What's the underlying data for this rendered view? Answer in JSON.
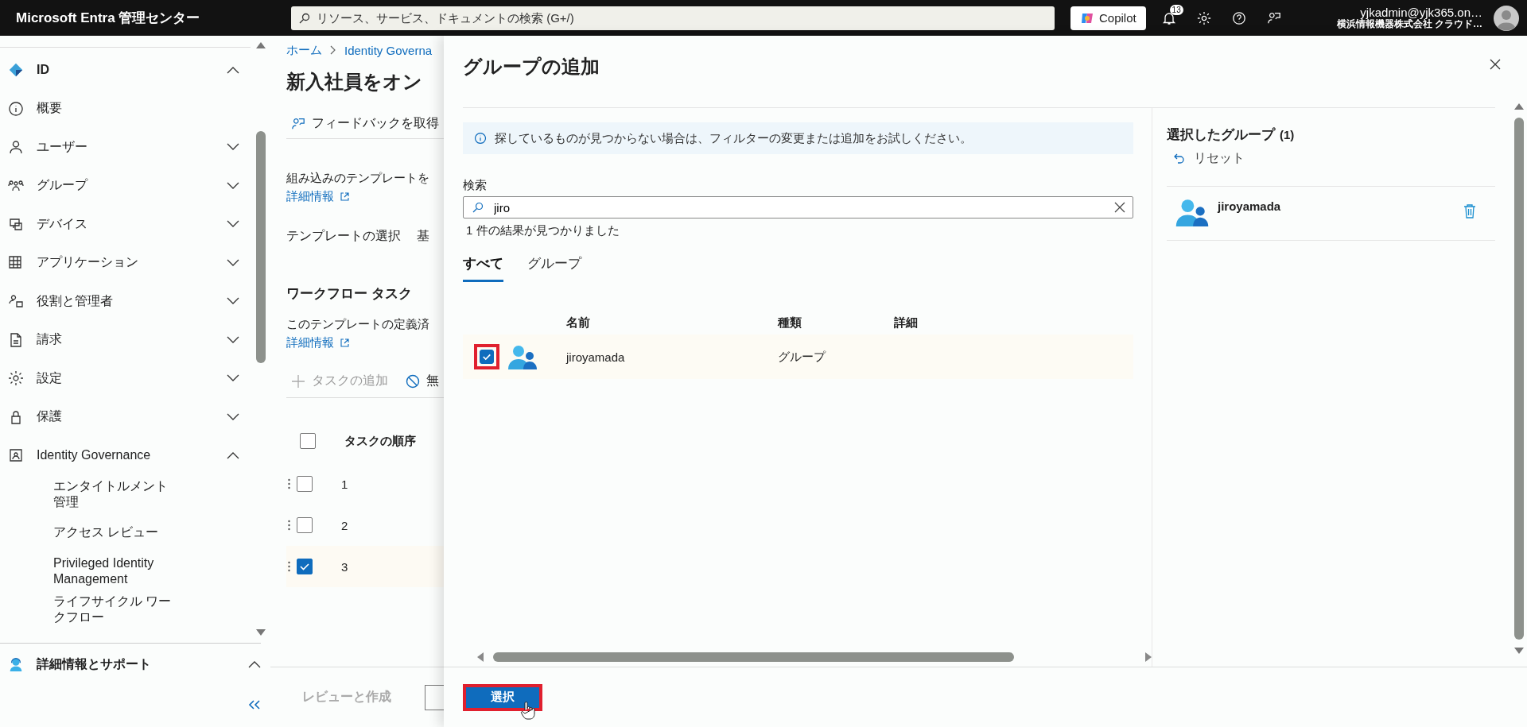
{
  "top_bar": {
    "title": "Microsoft Entra 管理センター",
    "search": {
      "placeholder": "リソース、サービス、ドキュメントの検索 (G+/)"
    },
    "copilot_button": "Copilot",
    "notifications_badge": "13",
    "account": {
      "email": "yjkadmin@yjk365.on…",
      "organization": "横浜情報機器株式会社 クラウド…"
    }
  },
  "sidebar": {
    "items": [
      {
        "label": "ID",
        "expanded": true,
        "children": [
          {
            "label": "概要"
          },
          {
            "label": "ユーザー",
            "expanded": false
          },
          {
            "label": "グループ",
            "expanded": false
          },
          {
            "label": "デバイス",
            "expanded": false
          },
          {
            "label": "アプリケーション",
            "expanded": false
          },
          {
            "label": "役割と管理者",
            "expanded": false
          },
          {
            "label": "請求",
            "expanded": false
          },
          {
            "label": "設定",
            "expanded": false
          },
          {
            "label": "保護",
            "expanded": false
          },
          {
            "label": "Identity Governance",
            "expanded": true,
            "children": [
              {
                "label": "エンタイトルメント管理"
              },
              {
                "label": "アクセス レビュー"
              },
              {
                "label": "Privileged Identity Management"
              },
              {
                "label": "ライフサイクル ワークフロー"
              }
            ]
          }
        ]
      }
    ],
    "support": {
      "label": "詳細情報とサポート",
      "expanded": true
    }
  },
  "background_page": {
    "breadcrumb": [
      "ホーム",
      "Identity Governa"
    ],
    "title": "新入社員をオン",
    "feedback_button": "フィードバックを取得",
    "description": "組み込みのテンプレートを",
    "learn_more_link": "詳細情報",
    "tabs": [
      "テンプレートの選択",
      "基"
    ],
    "section_heading": "ワークフロー タスク",
    "section_description": "このテンプレートの定義済",
    "section_link": "詳細情報",
    "toolbar": [
      {
        "label": "タスクの追加",
        "disabled": true
      },
      {
        "label": "無",
        "disabled": false
      }
    ],
    "table": {
      "header_checked": false,
      "column": "タスクの順序",
      "rows": [
        {
          "order": "1",
          "selected": false
        },
        {
          "order": "2",
          "selected": false
        },
        {
          "order": "3",
          "selected": true
        }
      ]
    },
    "footer_button": {
      "label": "レビューと作成",
      "disabled": true
    }
  },
  "panel": {
    "title": "グループの追加",
    "info": "探しているものが見つからない場合は、フィルターの変更または追加をお試しください。",
    "search": {
      "label": "検索",
      "value": "jiro"
    },
    "result_count": "1 件の結果が見つかりました",
    "tabs": [
      {
        "label": "すべて",
        "selected": true
      },
      {
        "label": "グループ",
        "selected": false
      }
    ],
    "columns": [
      "名前",
      "種類",
      "詳細"
    ],
    "rows": [
      {
        "name": "jiroyamada",
        "type": "グループ",
        "checked": true,
        "highlighted": true
      }
    ],
    "selected_pane": {
      "title": "選択したグループ",
      "count": "(1)",
      "reset": "リセット",
      "items": [
        "jiroyamada"
      ]
    },
    "select_button": {
      "label": "選択",
      "highlighted": true
    }
  }
}
